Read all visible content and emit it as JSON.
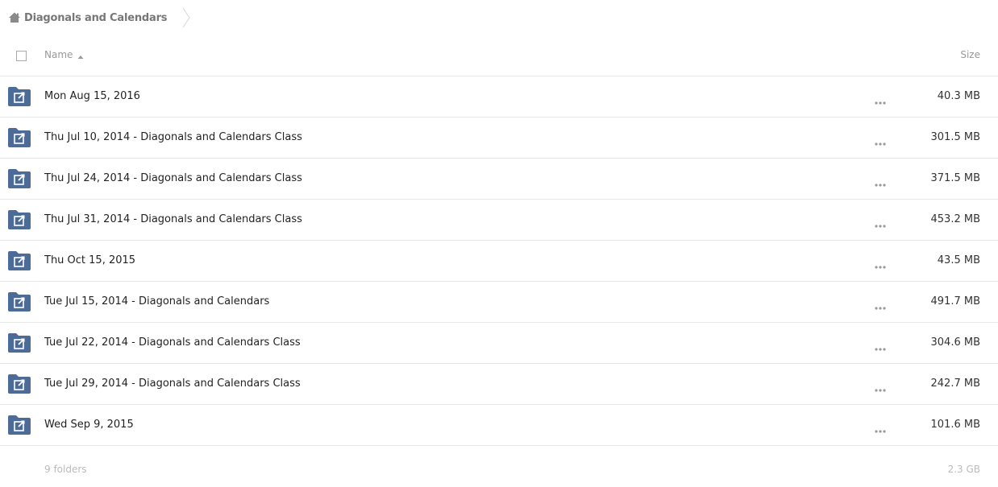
{
  "breadcrumb": {
    "icon": "home-icon",
    "label": "Diagonals and Calendars"
  },
  "header": {
    "name_label": "Name",
    "size_label": "Size",
    "sort_icon": "sort-ascending-icon"
  },
  "colors": {
    "folder": "#4c6b96",
    "muted_text": "#999999",
    "divider": "#e6e6e6"
  },
  "rows": [
    {
      "name": "Mon Aug 15, 2016",
      "size": "40.3 MB",
      "icon": "shared-folder-icon"
    },
    {
      "name": "Thu Jul 10, 2014 - Diagonals and Calendars Class",
      "size": "301.5 MB",
      "icon": "shared-folder-icon"
    },
    {
      "name": "Thu Jul 24, 2014 - Diagonals and Calendars Class",
      "size": "371.5 MB",
      "icon": "shared-folder-icon"
    },
    {
      "name": "Thu Jul 31, 2014 - Diagonals and Calendars Class",
      "size": "453.2 MB",
      "icon": "shared-folder-icon"
    },
    {
      "name": "Thu Oct 15, 2015",
      "size": "43.5 MB",
      "icon": "shared-folder-icon"
    },
    {
      "name": "Tue Jul 15, 2014 - Diagonals and Calendars",
      "size": "491.7 MB",
      "icon": "shared-folder-icon"
    },
    {
      "name": "Tue Jul 22, 2014 - Diagonals and Calendars Class",
      "size": "304.6 MB",
      "icon": "shared-folder-icon"
    },
    {
      "name": "Tue Jul 29, 2014 - Diagonals and Calendars Class",
      "size": "242.7 MB",
      "icon": "shared-folder-icon"
    },
    {
      "name": "Wed Sep 9, 2015",
      "size": "101.6 MB",
      "icon": "shared-folder-icon"
    }
  ],
  "summary": {
    "count": "9 folders",
    "total": "2.3 GB"
  }
}
